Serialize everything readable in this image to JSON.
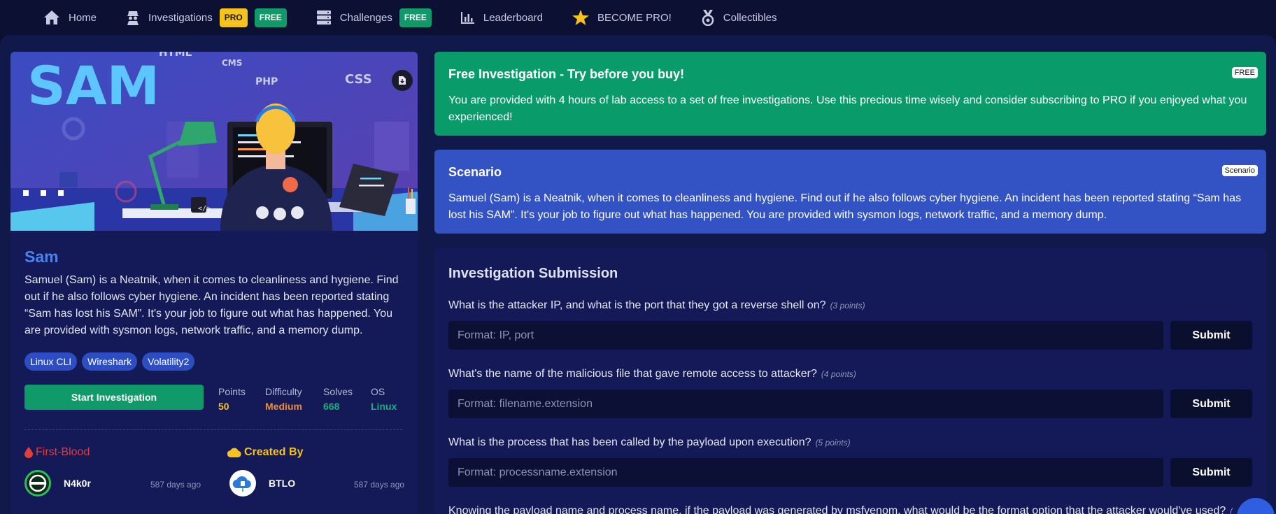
{
  "nav": {
    "items": [
      {
        "label": "Home",
        "icon": "home-icon"
      },
      {
        "label": "Investigations",
        "icon": "detective-icon",
        "badges": [
          "PRO",
          "FREE"
        ]
      },
      {
        "label": "Challenges",
        "icon": "server-icon",
        "badges": [
          "FREE"
        ]
      },
      {
        "label": "Leaderboard",
        "icon": "chart-icon"
      },
      {
        "label": "BECOME PRO!",
        "icon": "star-icon"
      },
      {
        "label": "Collectibles",
        "icon": "medal-icon"
      }
    ]
  },
  "lab": {
    "title": "Sam",
    "description": "Samuel (Sam) is a Neatnik, when it comes to cleanliness and hygiene. Find out if he also follows cyber hygiene. An incident has been reported stating “Sam has lost his SAM”. It's your job to figure out what has happened. You are provided with sysmon logs, network traffic, and a memory dump.",
    "tags": [
      "Linux CLI",
      "Wireshark",
      "Volatility2"
    ],
    "start_label": "Start Investigation",
    "stats": {
      "points_label": "Points",
      "points": "50",
      "difficulty_label": "Difficulty",
      "difficulty": "Medium",
      "solves_label": "Solves",
      "solves": "668",
      "os_label": "OS",
      "os": "Linux"
    },
    "banner": {
      "title": "SAM",
      "words": [
        "HTML",
        "CMS",
        "PHP",
        "CSS",
        "</>"
      ]
    },
    "first_blood": {
      "heading": "First-Blood",
      "name": "N4k0r",
      "time": "587 days ago"
    },
    "created_by": {
      "heading": "Created By",
      "name": "BTLO",
      "time": "587 days ago"
    }
  },
  "free_panel": {
    "title": "Free Investigation - Try before you buy!",
    "badge": "FREE",
    "text": "You are provided with 4 hours of lab access to a set of free investigations. Use this precious time wisely and consider subscribing to PRO if you enjoyed what you experienced!"
  },
  "scenario_panel": {
    "title": "Scenario",
    "badge": "Scenario",
    "text": "Samuel (Sam) is a Neatnik, when it comes to cleanliness and hygiene. Find out if he also follows cyber hygiene. An incident has been reported stating “Sam has lost his SAM”. It's your job to figure out what has happened. You are provided with sysmon logs, network traffic, and a memory dump."
  },
  "submission": {
    "title": "Investigation Submission",
    "submit_label": "Submit",
    "questions": [
      {
        "text": "What is the attacker IP, and what is the port that they got a reverse shell on?",
        "points": "(3 points)",
        "placeholder": "Format: IP, port"
      },
      {
        "text": "What's the name of the malicious file that gave remote access to attacker?",
        "points": "(4 points)",
        "placeholder": "Format: filename.extension"
      },
      {
        "text": "What is the process that has been called by the payload upon execution?",
        "points": "(5 points)",
        "placeholder": "Format: processname.extension"
      },
      {
        "text": "Knowing the payload name and process name, if the payload was generated by msfvenom, what would be the format option that the attacker would've used?",
        "points": "(",
        "placeholder": ""
      }
    ]
  },
  "colors": {
    "accent_green": "#109a6a",
    "accent_blue": "#3353c5",
    "pro_yellow": "#f6c21d",
    "difficulty_orange": "#f28a2e",
    "first_blood_red": "#e23c3c"
  }
}
